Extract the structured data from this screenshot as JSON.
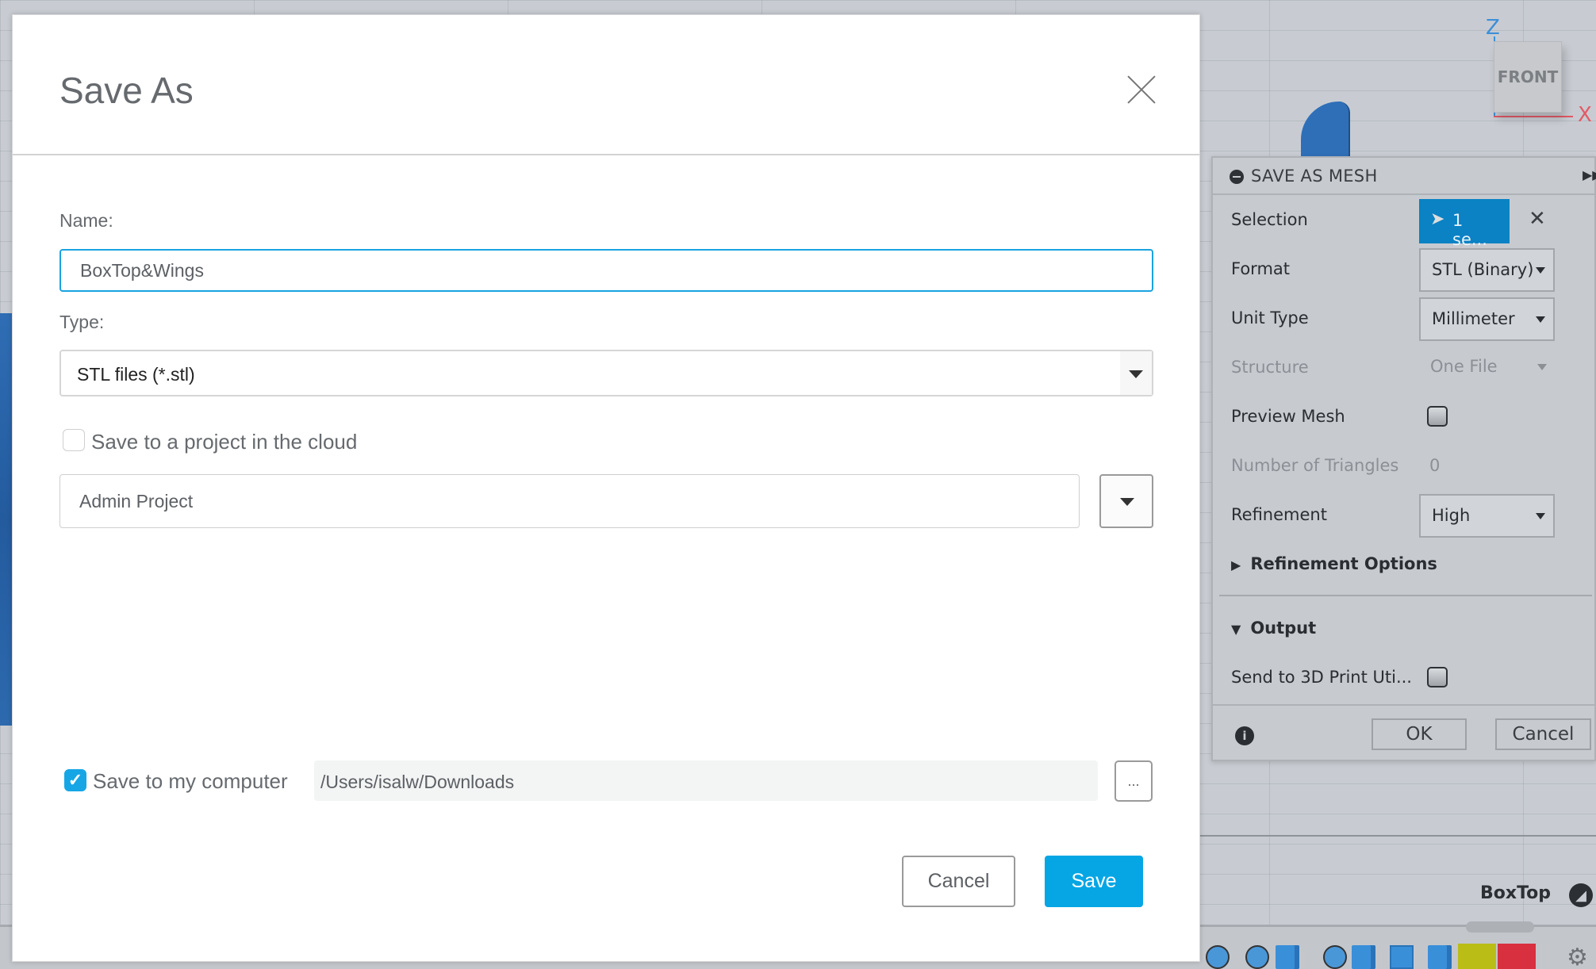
{
  "dialog": {
    "title": "Save As",
    "close_icon": "close-icon",
    "name_label": "Name:",
    "name_value": "BoxTop&Wings",
    "type_label": "Type:",
    "type_value": "STL files (*.stl)",
    "cloud_checkbox_label": "Save to a project in the cloud",
    "cloud_checked": false,
    "project_value": "Admin Project",
    "computer_checkbox_label": "Save to my computer",
    "computer_checked": true,
    "checkmark": "✓",
    "path_value": "/Users/isalw/Downloads",
    "browse_label": "...",
    "cancel_label": "Cancel",
    "save_label": "Save",
    "accent_color": "#06a6e4"
  },
  "mesh_panel": {
    "title": "SAVE AS MESH",
    "expand_icon": "▶▶",
    "selection_label": "Selection",
    "selection_value": "1 se...",
    "clear_icon": "✕",
    "format_label": "Format",
    "format_value": "STL (Binary)",
    "unit_type_label": "Unit Type",
    "unit_type_value": "Millimeter",
    "structure_label": "Structure",
    "structure_value": "One File",
    "preview_mesh_label": "Preview Mesh",
    "preview_mesh_checked": false,
    "triangles_label": "Number of Triangles",
    "triangles_value": "0",
    "refinement_label": "Refinement",
    "refinement_value": "High",
    "refinement_options_label": "Refinement Options",
    "output_label": "Output",
    "send_to_3d_print_label": "Send to 3D Print Uti...",
    "send_to_3d_print_checked": false,
    "info_icon": "i",
    "ok_label": "OK",
    "cancel_label": "Cancel"
  },
  "viewport": {
    "view_cube_face": "FRONT",
    "axis_z": "Z",
    "axis_x": "X",
    "document_name": "BoxTop",
    "settings_icon": "⚙"
  }
}
